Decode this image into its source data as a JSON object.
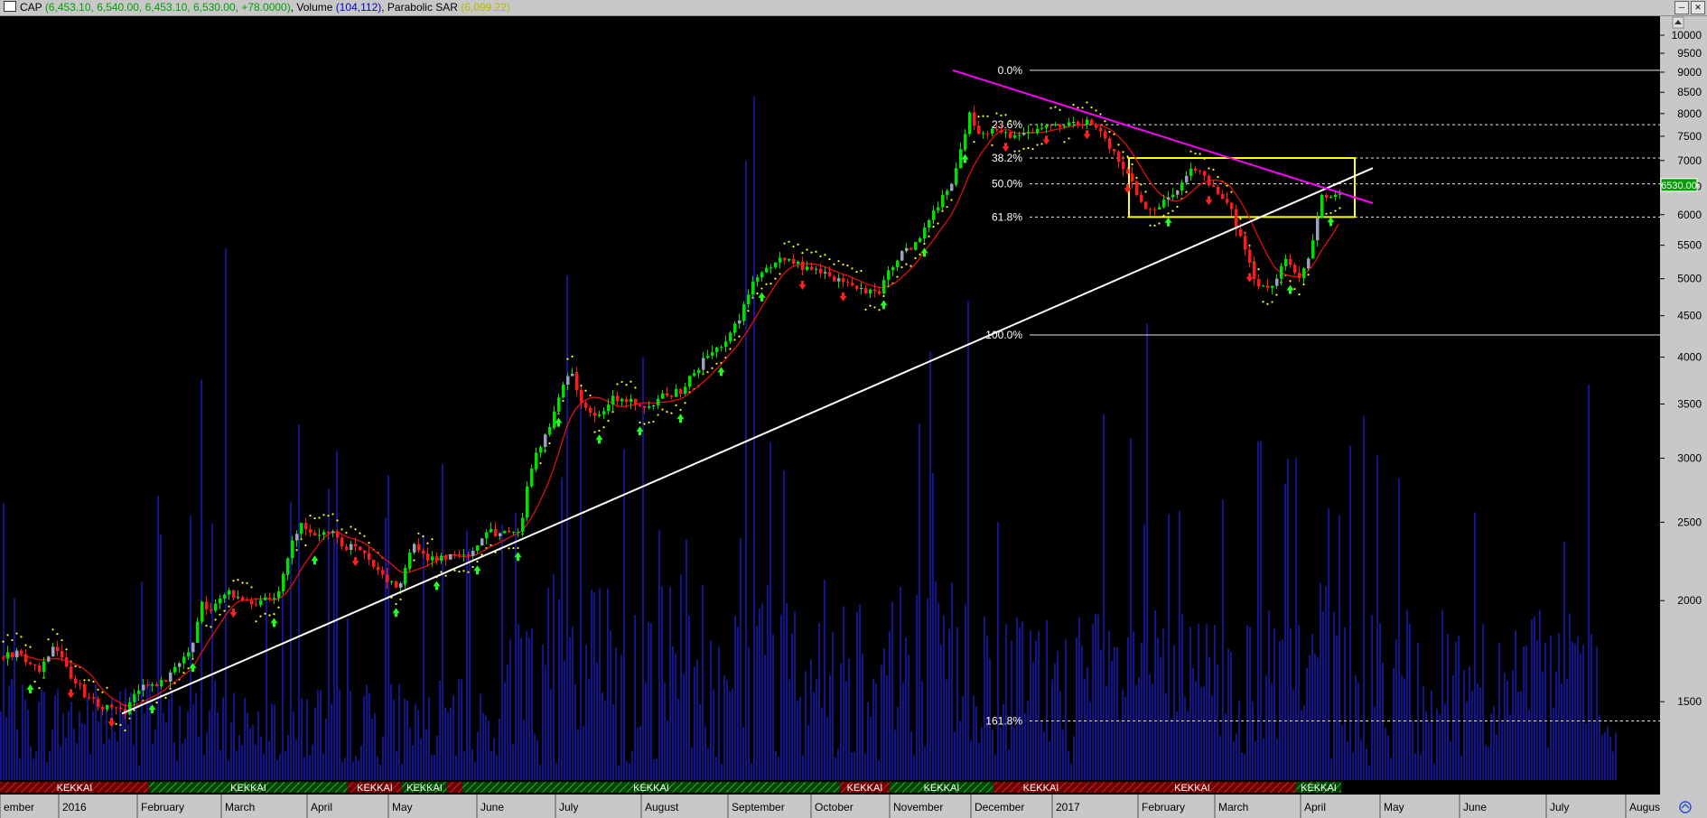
{
  "title_bar": {
    "symbol": "CAP",
    "price_text": "(6,453.10, 6,540.00, 6,453.10, 6,530.00, +78.0000)",
    "volume_label": "Volume",
    "volume_text": "(104,112)",
    "sar_label": "Parabolic SAR",
    "sar_text": "(6,099.22)",
    "colors": {
      "price": "#00a000",
      "volume": "#0000cc",
      "sar": "#d8d800"
    }
  },
  "chart_data": {
    "type": "candlestick",
    "y_scale": "log",
    "ylim": [
      1200,
      10500
    ],
    "y_ticks": [
      10000,
      9500,
      9000,
      8500,
      8000,
      7500,
      7000,
      6500,
      6000,
      5500,
      5000,
      4500,
      4000,
      3500,
      3000,
      2500,
      2000,
      1500
    ],
    "last_price_label": "6530.00",
    "x_months": [
      "ember",
      "2016",
      "February",
      "March",
      "April",
      "May",
      "June",
      "July",
      "August",
      "September",
      "October",
      "November",
      "December",
      "2017",
      "February",
      "March",
      "April",
      "May",
      "June",
      "July",
      "Augus"
    ],
    "price_path": [
      [
        0,
        1700
      ],
      [
        20,
        1720
      ],
      [
        40,
        1640
      ],
      [
        60,
        1760
      ],
      [
        75,
        1620
      ],
      [
        95,
        1520
      ],
      [
        115,
        1480
      ],
      [
        135,
        1450
      ],
      [
        155,
        1560
      ],
      [
        175,
        1570
      ],
      [
        195,
        1660
      ],
      [
        210,
        1730
      ],
      [
        220,
        1980
      ],
      [
        235,
        1950
      ],
      [
        250,
        2060
      ],
      [
        265,
        2010
      ],
      [
        285,
        1990
      ],
      [
        305,
        2020
      ],
      [
        318,
        2280
      ],
      [
        330,
        2480
      ],
      [
        345,
        2400
      ],
      [
        360,
        2460
      ],
      [
        380,
        2340
      ],
      [
        400,
        2300
      ],
      [
        420,
        2150
      ],
      [
        440,
        2090
      ],
      [
        455,
        2330
      ],
      [
        475,
        2250
      ],
      [
        495,
        2270
      ],
      [
        515,
        2260
      ],
      [
        535,
        2420
      ],
      [
        555,
        2440
      ],
      [
        575,
        2460
      ],
      [
        585,
        2920
      ],
      [
        600,
        3130
      ],
      [
        615,
        3530
      ],
      [
        630,
        3880
      ],
      [
        645,
        3450
      ],
      [
        660,
        3360
      ],
      [
        675,
        3560
      ],
      [
        695,
        3520
      ],
      [
        715,
        3430
      ],
      [
        735,
        3590
      ],
      [
        755,
        3660
      ],
      [
        775,
        3940
      ],
      [
        795,
        4100
      ],
      [
        815,
        4400
      ],
      [
        835,
        5000
      ],
      [
        850,
        5150
      ],
      [
        870,
        5340
      ],
      [
        890,
        5150
      ],
      [
        910,
        5120
      ],
      [
        930,
        4950
      ],
      [
        950,
        4850
      ],
      [
        970,
        4800
      ],
      [
        990,
        5300
      ],
      [
        1010,
        5450
      ],
      [
        1030,
        6000
      ],
      [
        1050,
        6500
      ],
      [
        1060,
        7000
      ],
      [
        1072,
        8000
      ],
      [
        1085,
        7500
      ],
      [
        1100,
        7700
      ],
      [
        1120,
        7500
      ],
      [
        1140,
        7600
      ],
      [
        1160,
        7800
      ],
      [
        1180,
        7700
      ],
      [
        1200,
        7800
      ],
      [
        1220,
        7500
      ],
      [
        1235,
        7100
      ],
      [
        1250,
        6700
      ],
      [
        1265,
        6050
      ],
      [
        1280,
        6100
      ],
      [
        1300,
        6400
      ],
      [
        1320,
        6850
      ],
      [
        1340,
        6500
      ],
      [
        1360,
        6150
      ],
      [
        1375,
        5450
      ],
      [
        1390,
        4900
      ],
      [
        1405,
        4850
      ],
      [
        1420,
        5300
      ],
      [
        1435,
        5000
      ],
      [
        1450,
        5400
      ],
      [
        1460,
        6300
      ],
      [
        1475,
        6350
      ],
      [
        1485,
        6530
      ]
    ],
    "volume_spikes": [
      [
        248,
        5450
      ],
      [
        222,
        3750
      ],
      [
        330,
        3300
      ],
      [
        628,
        5050
      ],
      [
        834,
        8400
      ],
      [
        824,
        7000
      ],
      [
        1072,
        4700
      ],
      [
        1268,
        4400
      ],
      [
        1222,
        3400
      ],
      [
        1395,
        3150
      ],
      [
        1470,
        2600
      ],
      [
        1482,
        2550
      ]
    ],
    "sar_labels": [
      "0.0%",
      "23.6%",
      "38.2%",
      "50.0%",
      "61.8%",
      "100.0%",
      "161.8%"
    ],
    "fib_levels": [
      {
        "label": "0.0%",
        "value": 9050,
        "style": "solid"
      },
      {
        "label": "23.6%",
        "value": 7750,
        "style": "dashed"
      },
      {
        "label": "38.2%",
        "value": 7050,
        "style": "dashed"
      },
      {
        "label": "50.0%",
        "value": 6550,
        "style": "dashed"
      },
      {
        "label": "61.8%",
        "value": 5960,
        "style": "dashed"
      },
      {
        "label": "100.0%",
        "value": 4260,
        "style": "solid"
      },
      {
        "label": "161.8%",
        "value": 1420,
        "style": "dashed"
      }
    ],
    "trendlines": [
      {
        "name": "support",
        "color": "#ffffff",
        "from": [
          135,
          1450
        ],
        "to": [
          1520,
          6850
        ]
      },
      {
        "name": "resistance",
        "color": "#ff00ff",
        "from": [
          1055,
          9050
        ],
        "to": [
          1520,
          6200
        ]
      }
    ],
    "box": {
      "x": [
        1250,
        1500
      ],
      "y": [
        5960,
        7050
      ],
      "color": "#ffff00"
    },
    "signal_bands": [
      {
        "label": "KEKKAI",
        "x0": 0,
        "x1": 165,
        "kind": "sell"
      },
      {
        "label": "KEKKAI",
        "x0": 165,
        "x1": 385,
        "kind": "buy"
      },
      {
        "label": "KEKKAI",
        "x0": 385,
        "x1": 445,
        "kind": "sell"
      },
      {
        "label": "KEKKAI",
        "x0": 445,
        "x1": 495,
        "kind": "buy"
      },
      {
        "label": "KEKKAI",
        "x0": 495,
        "x1": 512,
        "kind": "sell"
      },
      {
        "label": "KEKKAI",
        "x0": 512,
        "x1": 930,
        "kind": "buy"
      },
      {
        "label": "KEKKAI",
        "x0": 930,
        "x1": 985,
        "kind": "sell"
      },
      {
        "label": "KEKKAI",
        "x0": 985,
        "x1": 1100,
        "kind": "buy"
      },
      {
        "label": "KEKKAI",
        "x0": 1100,
        "x1": 1205,
        "kind": "sell"
      },
      {
        "label": "KEKKAI",
        "x0": 1205,
        "x1": 1435,
        "kind": "sell"
      },
      {
        "label": "KEKKAI",
        "x0": 1435,
        "x1": 1485,
        "kind": "buy"
      }
    ]
  }
}
